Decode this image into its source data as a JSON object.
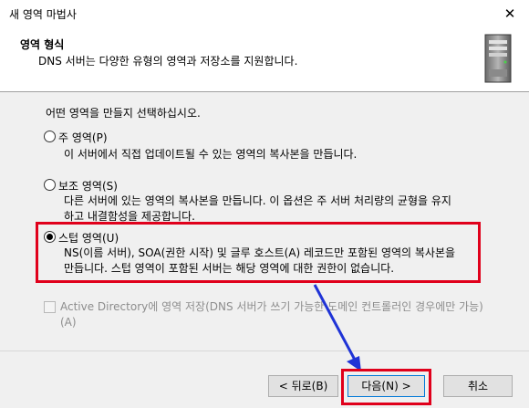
{
  "window": {
    "title": "새 영역 마법사"
  },
  "header": {
    "title": "영역 형식",
    "description": "DNS 서버는 다양한 유형의 영역과 저장소를 지원합니다."
  },
  "prompt": "어떤 영역을 만들지 선택하십시오.",
  "options": [
    {
      "label": "주 영역(P)",
      "description": [
        "이 서버에서 직접 업데이트될 수 있는 영역의 복사본을 만듭니다."
      ],
      "selected": false
    },
    {
      "label": "보조 영역(S)",
      "description": [
        "다른 서버에 있는 영역의 복사본을 만듭니다. 이 옵션은 주 서버 처리량의 균형을 유지",
        "하고 내결함성을 제공합니다."
      ],
      "selected": false
    },
    {
      "label": "스텁 영역(U)",
      "description": [
        "NS(이름 서버), SOA(권한 시작) 및 글루 호스트(A) 레코드만 포함된 영역의 복사본을",
        "만듭니다. 스텁 영역이 포함된 서버는 해당 영역에 대한 권한이 없습니다."
      ],
      "selected": true
    }
  ],
  "ad_checkbox": {
    "label": "Active Directory에 영역 저장(DNS 서버가 쓰기 가능한 도메인 컨트롤러인 경우에만 가능)(A)",
    "checked": false,
    "enabled": false
  },
  "buttons": {
    "back": "< 뒤로(B)",
    "next": "다음(N) >",
    "cancel": "취소"
  },
  "icons": {
    "close": "close-icon",
    "server": "server-icon"
  },
  "colors": {
    "highlight": "#e0001b",
    "arrow": "#1f33d6",
    "accent": "#0078d7"
  }
}
